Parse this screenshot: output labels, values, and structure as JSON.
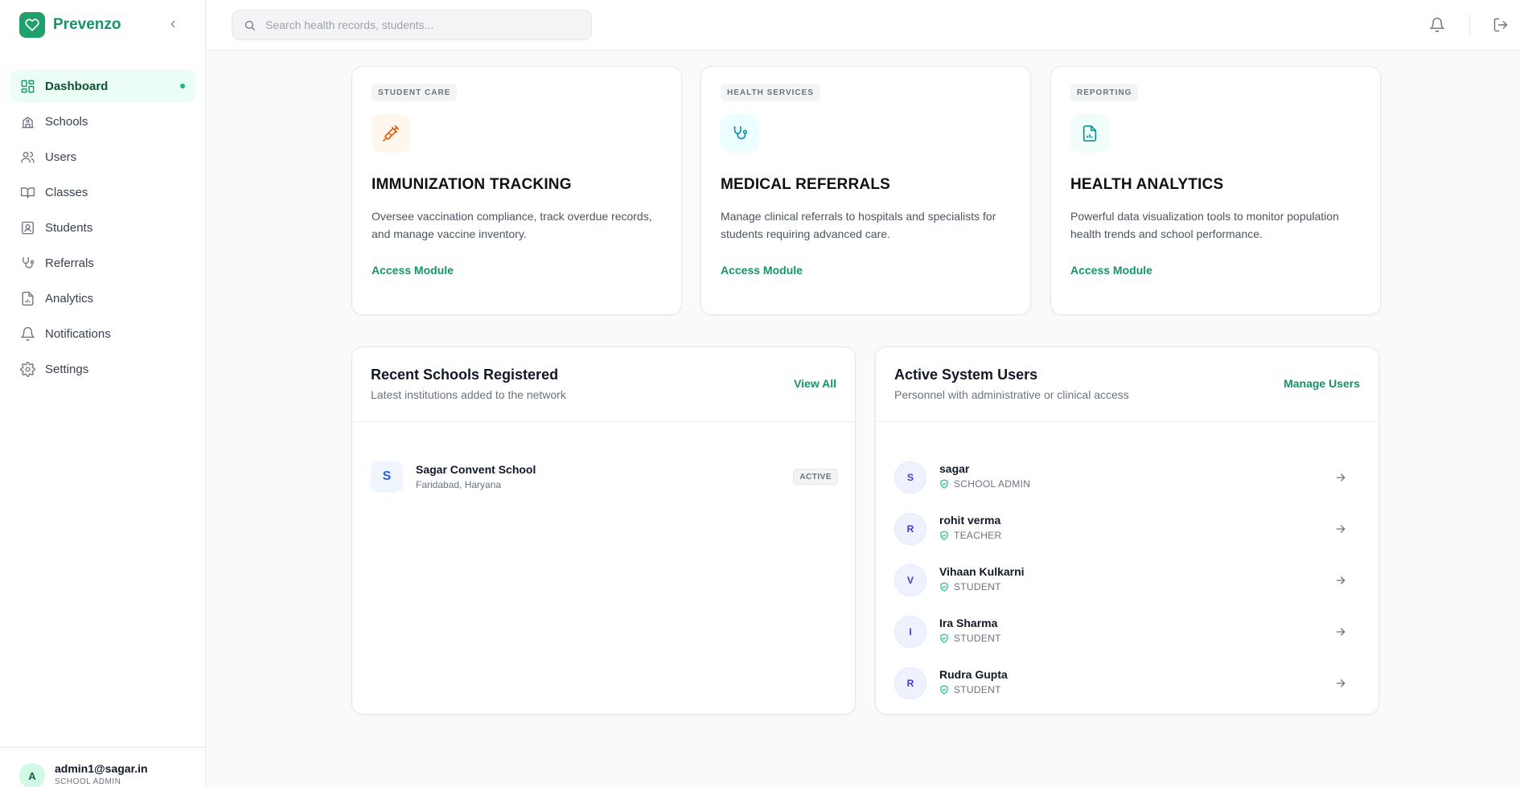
{
  "brand": {
    "name": "Prevenzo"
  },
  "sidebar": {
    "items": [
      {
        "label": "Dashboard",
        "icon": "dashboard-icon",
        "active": true
      },
      {
        "label": "Schools",
        "icon": "school-icon"
      },
      {
        "label": "Users",
        "icon": "users-icon"
      },
      {
        "label": "Classes",
        "icon": "book-icon"
      },
      {
        "label": "Students",
        "icon": "student-icon"
      },
      {
        "label": "Referrals",
        "icon": "stethoscope-icon"
      },
      {
        "label": "Analytics",
        "icon": "analytics-icon"
      },
      {
        "label": "Notifications",
        "icon": "bell-icon"
      },
      {
        "label": "Settings",
        "icon": "gear-icon"
      }
    ],
    "user": {
      "initial": "A",
      "email": "admin1@sagar.in",
      "role": "SCHOOL ADMIN"
    }
  },
  "header": {
    "search_placeholder": "Search health records, students..."
  },
  "modules": [
    {
      "tag": "STUDENT CARE",
      "title": "IMMUNIZATION TRACKING",
      "description": "Oversee vaccination compliance, track overdue records, and manage vaccine inventory.",
      "link": "Access Module",
      "icon": "syringe-icon"
    },
    {
      "tag": "HEALTH SERVICES",
      "title": "MEDICAL REFERRALS",
      "description": "Manage clinical referrals to hospitals and specialists for students requiring advanced care.",
      "link": "Access Module",
      "icon": "stethoscope-icon"
    },
    {
      "tag": "REPORTING",
      "title": "HEALTH ANALYTICS",
      "description": "Powerful data visualization tools to monitor population health trends and school performance.",
      "link": "Access Module",
      "icon": "report-icon"
    }
  ],
  "recent_schools": {
    "title": "Recent Schools Registered",
    "subtitle": "Latest institutions added to the network",
    "action": "View All",
    "items": [
      {
        "initial": "S",
        "name": "Sagar Convent School",
        "location": "Faridabad, Haryana",
        "status": "ACTIVE"
      }
    ]
  },
  "active_users": {
    "title": "Active System Users",
    "subtitle": "Personnel with administrative or clinical access",
    "action": "Manage Users",
    "items": [
      {
        "initial": "S",
        "name": "sagar",
        "role": "SCHOOL ADMIN"
      },
      {
        "initial": "R",
        "name": "rohit verma",
        "role": "TEACHER"
      },
      {
        "initial": "V",
        "name": "Vihaan Kulkarni",
        "role": "STUDENT"
      },
      {
        "initial": "I",
        "name": "Ira Sharma",
        "role": "STUDENT"
      },
      {
        "initial": "R",
        "name": "Rudra Gupta",
        "role": "STUDENT"
      }
    ]
  },
  "colors": {
    "accent": "#15936a",
    "brand": "#22a06b",
    "active_bg": "#ecfdf5"
  }
}
